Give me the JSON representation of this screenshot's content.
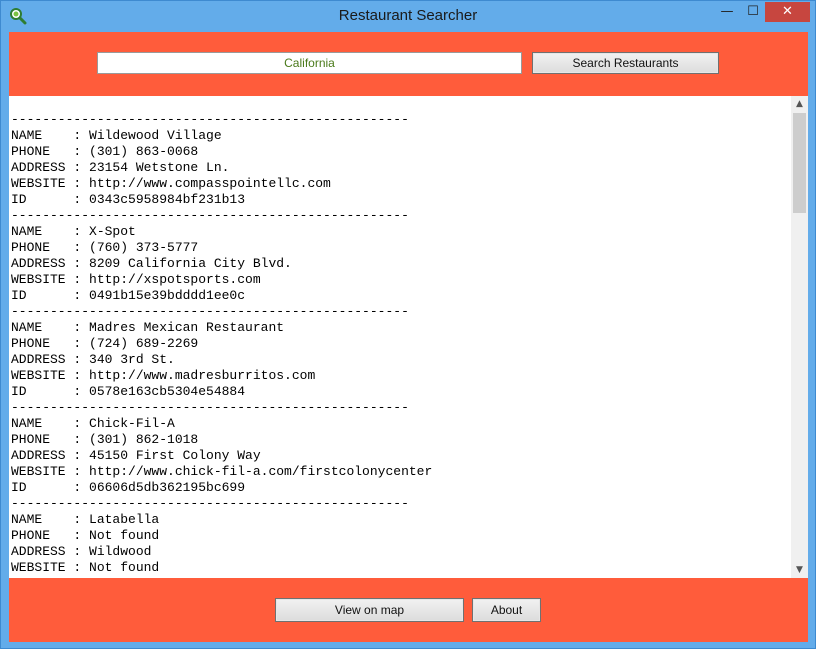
{
  "window": {
    "title": "Restaurant Searcher",
    "controls": {
      "minimize": "—",
      "maximize": "☐",
      "close": "✕"
    }
  },
  "icons": {
    "app": "magnifier-icon"
  },
  "colors": {
    "accent": "#ff5c3b",
    "titlebar": "#63acea",
    "close": "#c7463f"
  },
  "search": {
    "value": "California",
    "button_label": "Search Restaurants"
  },
  "results": {
    "text": "---------------------------------------------------\nNAME    : Wildewood Village\nPHONE   : (301) 863-0068\nADDRESS : 23154 Wetstone Ln.\nWEBSITE : http://www.compasspointellc.com\nID      : 0343c5958984bf231b13\n---------------------------------------------------\nNAME    : X-Spot\nPHONE   : (760) 373-5777\nADDRESS : 8209 California City Blvd.\nWEBSITE : http://xspotsports.com\nID      : 0491b15e39bdddd1ee0c\n---------------------------------------------------\nNAME    : Madres Mexican Restaurant\nPHONE   : (724) 689-2269\nADDRESS : 340 3rd St.\nWEBSITE : http://www.madresburritos.com\nID      : 0578e163cb5304e54884\n---------------------------------------------------\nNAME    : Chick-Fil-A\nPHONE   : (301) 862-1018\nADDRESS : 45150 First Colony Way\nWEBSITE : http://www.chick-fil-a.com/firstcolonycenter\nID      : 06606d5db362195bc699\n---------------------------------------------------\nNAME    : Latabella\nPHONE   : Not found\nADDRESS : Wildwood\nWEBSITE : Not found"
  },
  "scrollbar": {
    "up": "▲",
    "down": "▼"
  },
  "footer": {
    "map_label": "View on map",
    "about_label": "About"
  }
}
